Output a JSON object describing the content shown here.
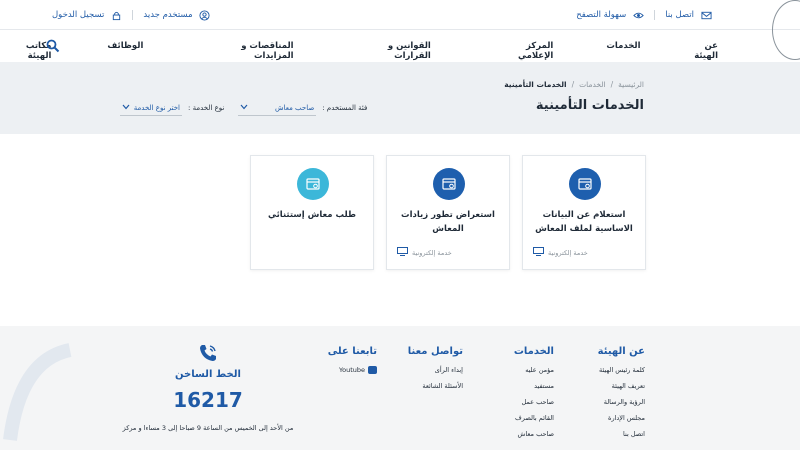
{
  "topbar": {
    "contact_label": "اتصل بنا",
    "accessibility_label": "سهولة التصفح",
    "new_user_label": "مستخدم جديد",
    "login_label": "تسجيل الدخول"
  },
  "nav": {
    "items": [
      "عن الهيئة",
      "الخدمات",
      "المركز الإعلامي",
      "القوانين و القرارات",
      "المناقصات و المزايدات",
      "الوظائف",
      "مكاتب الهيئة"
    ]
  },
  "breadcrumb": {
    "home": "الرئيسية",
    "services": "الخدمات",
    "current": "الخدمات التأمينية"
  },
  "page_title": "الخدمات التأمينية",
  "filters": {
    "user_category_label": "فئة المستخدم :",
    "user_category_value": "صاحب معاش",
    "service_type_label": "نوع الخدمة :",
    "service_type_value": "اختر نوع الخدمة"
  },
  "cards": [
    {
      "title": "استعلام عن البيانات الاساسية لملف المعاش",
      "type": "خدمة إلكترونية"
    },
    {
      "title": "استعراض تطور زيادات المعاش",
      "type": "خدمة إلكترونية"
    },
    {
      "title": "طلب معاش إستثنائي",
      "type": ""
    }
  ],
  "footer": {
    "about": {
      "title": "عن الهيئة",
      "links": [
        "كلمة رئيس الهيئة",
        "تعريف الهيئة",
        "الرؤية والرسالة",
        "مجلس الإدارة",
        "اتصل بنا"
      ]
    },
    "services": {
      "title": "الخدمات",
      "links": [
        "مؤمن عليه",
        "مستفيد",
        "صاحب عمل",
        "القائم بالصرف",
        "صاحب معاش"
      ]
    },
    "contact": {
      "title": "تواصل معنا",
      "links": [
        "إبداء الرأى",
        "الأسئلة الشائعة"
      ]
    },
    "follow": {
      "title": "تابعنا على",
      "youtube": "Youtube"
    },
    "hotline": {
      "title": "الخط الساخن",
      "number": "16217",
      "hours": "من الأحد إلى الخميس من الساعة 9 صباحا إلى 3 مساءا و مركز"
    }
  },
  "colors": {
    "brand": "#1f5aa6",
    "brand_dark": "#1e5fae",
    "accent_light": "#3cb7d9",
    "hero_bg": "#edf0f3"
  }
}
